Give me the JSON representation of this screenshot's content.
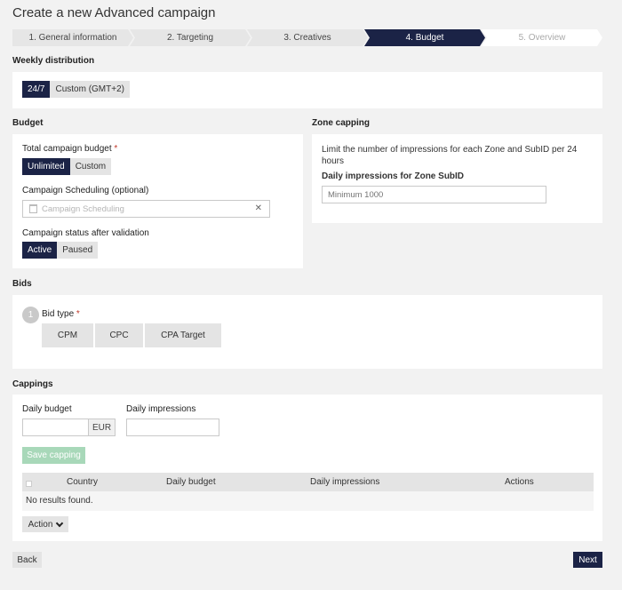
{
  "page": {
    "title": "Create a new Advanced campaign"
  },
  "stepper": {
    "steps": [
      {
        "label": "1. General information",
        "state": "done"
      },
      {
        "label": "2. Targeting",
        "state": "done"
      },
      {
        "label": "3. Creatives",
        "state": "done"
      },
      {
        "label": "4. Budget",
        "state": "active"
      },
      {
        "label": "5. Overview",
        "state": "future"
      }
    ]
  },
  "weekly": {
    "title": "Weekly distribution",
    "options": [
      "24/7",
      "Custom (GMT+2)"
    ],
    "selected": "24/7"
  },
  "budget": {
    "title": "Budget",
    "total_label": "Total campaign budget",
    "required_mark": "*",
    "total_options": [
      "Unlimited",
      "Custom"
    ],
    "total_selected": "Unlimited",
    "scheduling_label": "Campaign Scheduling (optional)",
    "scheduling_placeholder": "Campaign Scheduling",
    "clear_glyph": "✕",
    "status_label": "Campaign status after validation",
    "status_options": [
      "Active",
      "Paused"
    ],
    "status_selected": "Active"
  },
  "zone_capping": {
    "title": "Zone capping",
    "help": "Limit the number of impressions for each Zone and SubID per 24 hours",
    "field_label": "Daily impressions for Zone SubID",
    "field_placeholder": "Minimum 1000"
  },
  "bids": {
    "title": "Bids",
    "step_number": "1",
    "bid_type_label": "Bid type",
    "required_mark": "*",
    "options": [
      "CPM",
      "CPC",
      "CPA Target"
    ]
  },
  "cappings": {
    "title": "Cappings",
    "daily_budget_label": "Daily budget",
    "currency": "EUR",
    "daily_impressions_label": "Daily impressions",
    "save_label": "Save capping",
    "table": {
      "columns": [
        "Country",
        "Daily budget",
        "Daily impressions",
        "Actions"
      ],
      "empty": "No results found."
    },
    "action_label": "Action"
  },
  "footer": {
    "back_label": "Back",
    "next_label": "Next"
  },
  "colors": {
    "accent": "#1b2346",
    "save_disabled": "#a8d8b9",
    "required": "#c0392b"
  }
}
